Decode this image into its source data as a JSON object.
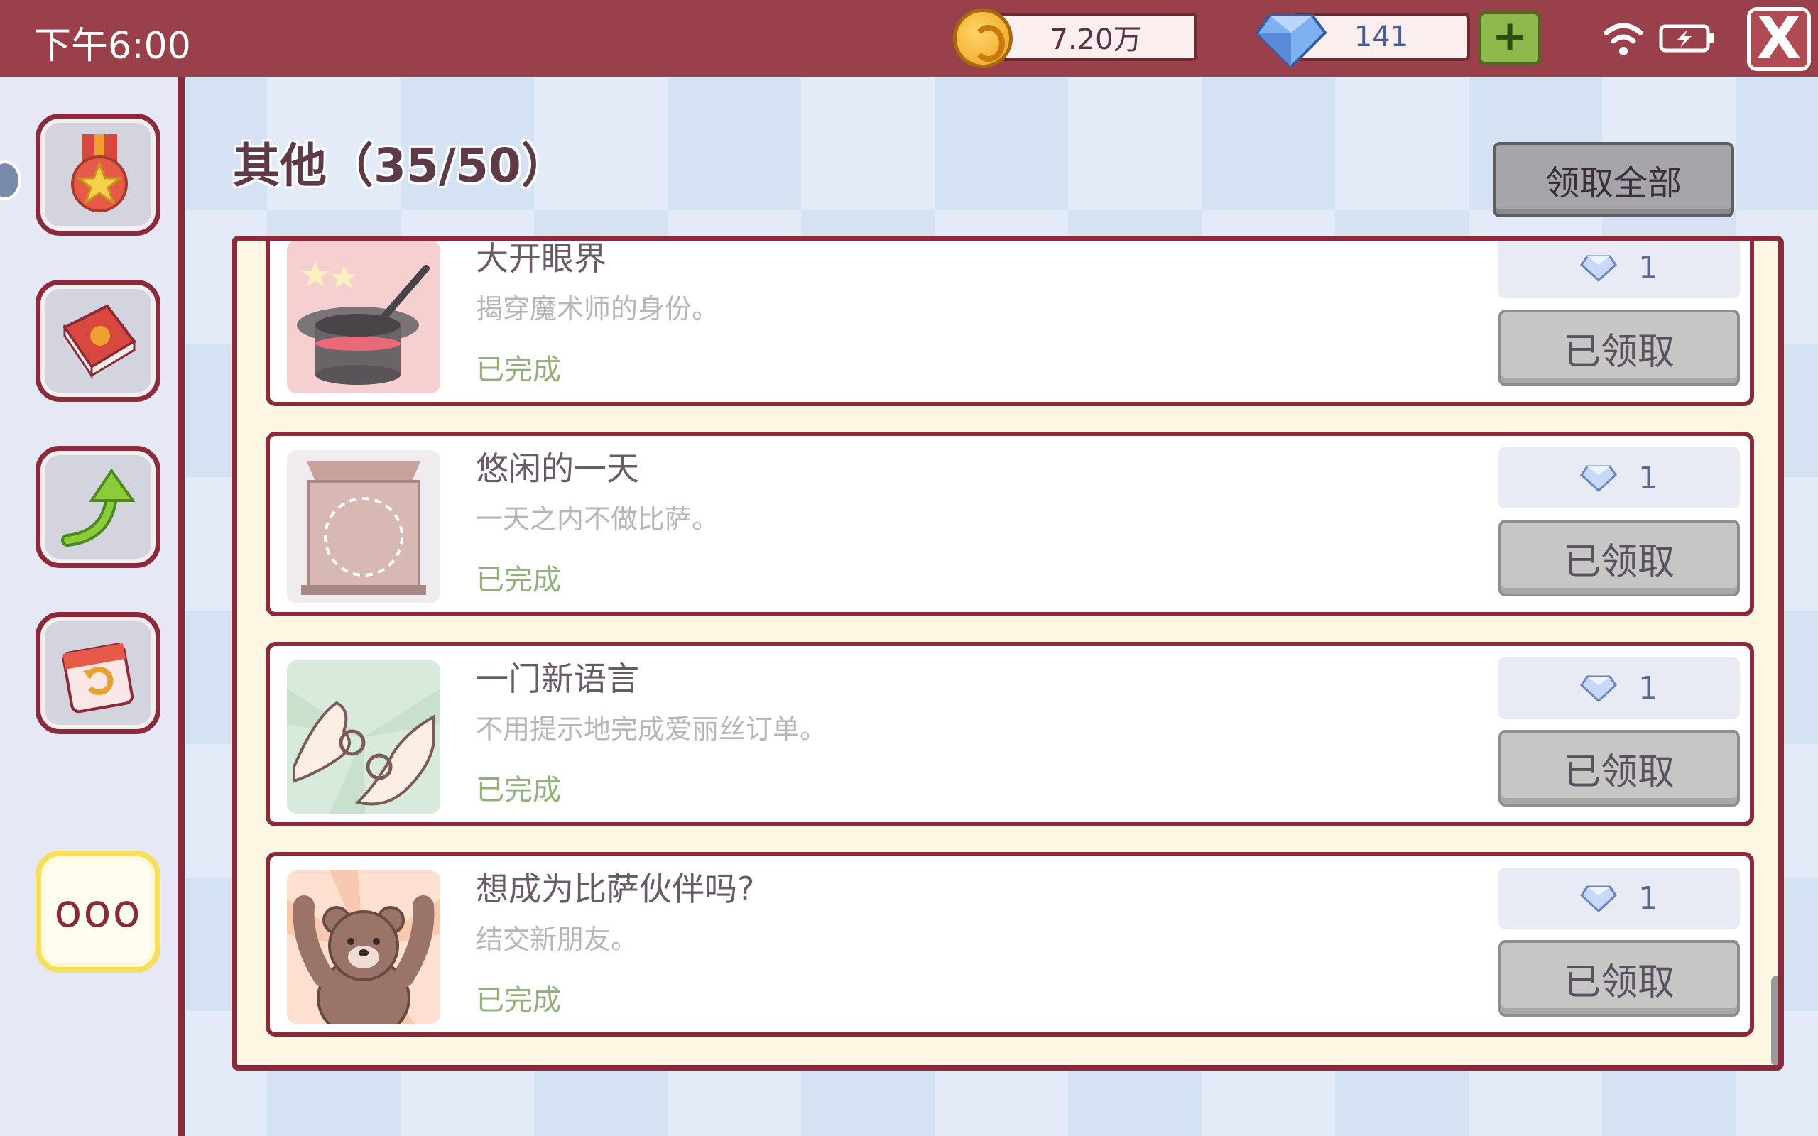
{
  "status_bar": {
    "time": "下午6:00"
  },
  "resources": {
    "coins": "7.20万",
    "gems": "141",
    "add_label": "+"
  },
  "close_label": "X",
  "sidebar": {
    "more_label": "ooo"
  },
  "header": {
    "title": "其他（35/50）",
    "claim_all_label": "领取全部"
  },
  "achievements": [
    {
      "title": "大开眼界",
      "description": "揭穿魔术师的身份。",
      "status": "已完成",
      "reward": "1",
      "button": "已领取",
      "icon": "magic-hat-icon"
    },
    {
      "title": "悠闲的一天",
      "description": "一天之内不做比萨。",
      "status": "已完成",
      "reward": "1",
      "button": "已领取",
      "icon": "pizza-box-icon"
    },
    {
      "title": "一门新语言",
      "description": "不用提示地完成爱丽丝订单。",
      "status": "已完成",
      "reward": "1",
      "button": "已领取",
      "icon": "hand-sign-icon"
    },
    {
      "title": "想成为比萨伙伴吗?",
      "description": "结交新朋友。",
      "status": "已完成",
      "reward": "1",
      "button": "已领取",
      "icon": "bear-icon"
    }
  ],
  "colors": {
    "topbar": "#99404a",
    "frame": "#8a2a3a",
    "status_green": "#8fb077"
  }
}
